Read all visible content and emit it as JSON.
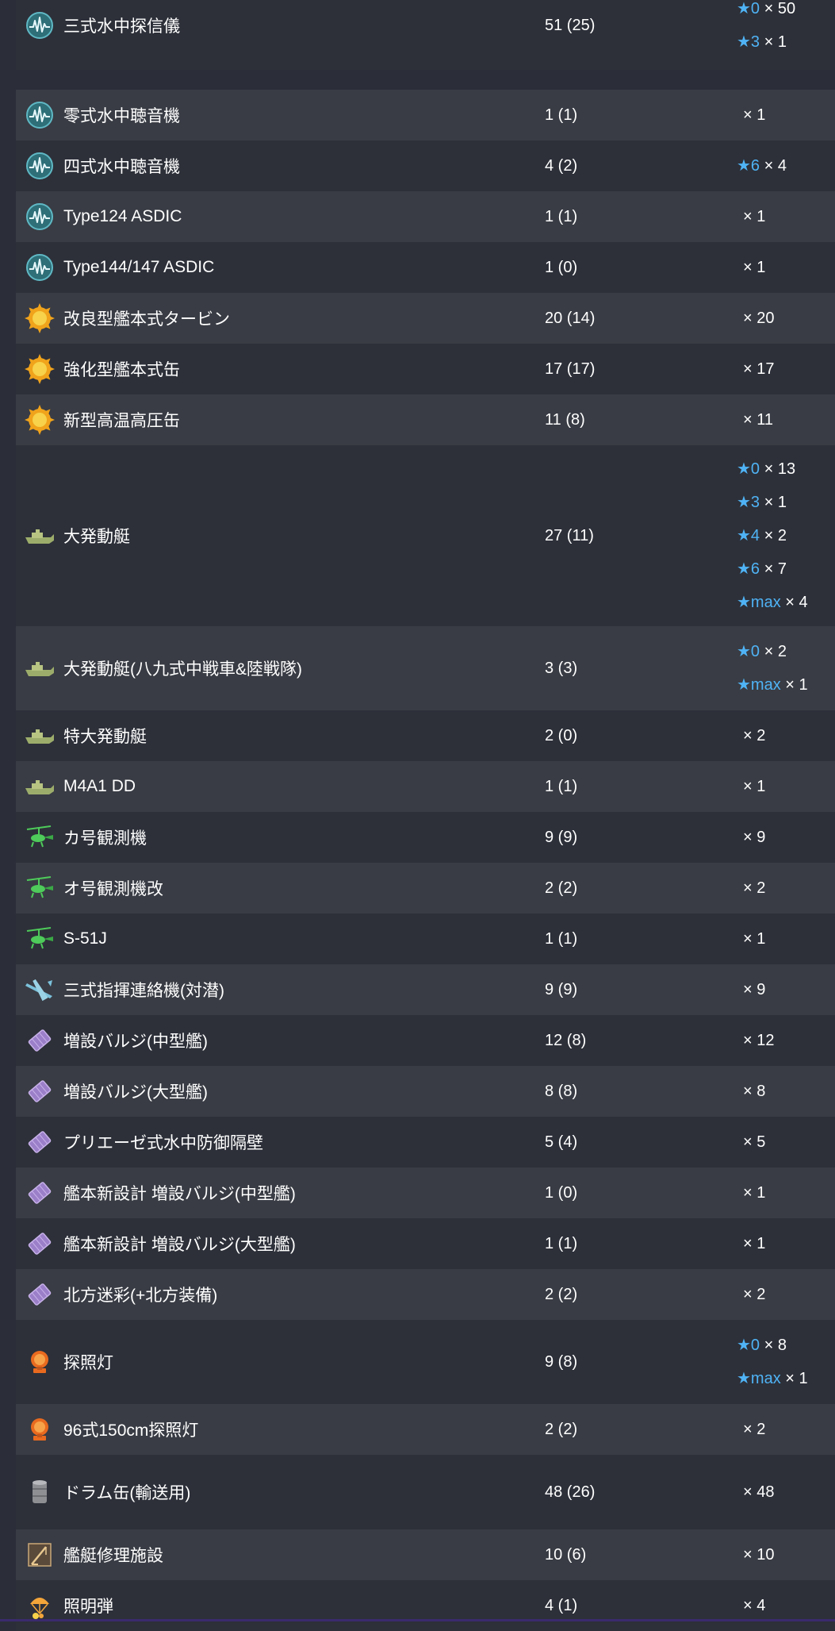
{
  "colors": {
    "row_odd": "#2d3039",
    "row_even": "#393c44",
    "star_level": "#4fb3f5",
    "text": "#ffffff"
  },
  "rows": [
    {
      "icon": "sonar-icon",
      "name": "三式水中探信儀",
      "count": "51 (25)",
      "stars": [
        {
          "level": "★0",
          "mult": "× 50"
        },
        {
          "level": "★3",
          "mult": "× 1"
        }
      ]
    },
    {
      "icon": "sonar-icon",
      "name": "零式水中聴音機",
      "count": "1 (1)",
      "stars": [
        {
          "level": "",
          "mult": "× 1"
        }
      ]
    },
    {
      "icon": "sonar-icon",
      "name": "四式水中聴音機",
      "count": "4 (2)",
      "stars": [
        {
          "level": "★6",
          "mult": "× 4"
        }
      ]
    },
    {
      "icon": "sonar-icon",
      "name": "Type124 ASDIC",
      "count": "1 (1)",
      "stars": [
        {
          "level": "",
          "mult": "× 1"
        }
      ]
    },
    {
      "icon": "sonar-icon",
      "name": "Type144/147 ASDIC",
      "count": "1 (0)",
      "stars": [
        {
          "level": "",
          "mult": "× 1"
        }
      ]
    },
    {
      "icon": "engine-icon",
      "name": "改良型艦本式タービン",
      "count": "20 (14)",
      "stars": [
        {
          "level": "",
          "mult": "× 20"
        }
      ]
    },
    {
      "icon": "engine-icon",
      "name": "強化型艦本式缶",
      "count": "17 (17)",
      "stars": [
        {
          "level": "",
          "mult": "× 17"
        }
      ]
    },
    {
      "icon": "engine-icon",
      "name": "新型高温高圧缶",
      "count": "11 (8)",
      "stars": [
        {
          "level": "",
          "mult": "× 11"
        }
      ]
    },
    {
      "icon": "landing-craft-icon",
      "name": "大発動艇",
      "count": "27 (11)",
      "stars": [
        {
          "level": "★0",
          "mult": "× 13"
        },
        {
          "level": "★3",
          "mult": "× 1"
        },
        {
          "level": "★4",
          "mult": "× 2"
        },
        {
          "level": "★6",
          "mult": "× 7"
        },
        {
          "level": "★max",
          "mult": "× 4"
        }
      ]
    },
    {
      "icon": "landing-craft-icon",
      "name": "大発動艇(八九式中戦車&陸戦隊)",
      "count": "3 (3)",
      "stars": [
        {
          "level": "★0",
          "mult": "× 2"
        },
        {
          "level": "★max",
          "mult": "× 1"
        }
      ]
    },
    {
      "icon": "landing-craft-icon",
      "name": "特大発動艇",
      "count": "2 (0)",
      "stars": [
        {
          "level": "",
          "mult": "× 2"
        }
      ]
    },
    {
      "icon": "landing-craft-icon",
      "name": "M4A1 DD",
      "count": "1 (1)",
      "stars": [
        {
          "level": "",
          "mult": "× 1"
        }
      ]
    },
    {
      "icon": "autogyro-icon",
      "name": "カ号観測機",
      "count": "9 (9)",
      "stars": [
        {
          "level": "",
          "mult": "× 9"
        }
      ]
    },
    {
      "icon": "autogyro-icon",
      "name": "オ号観測機改",
      "count": "2 (2)",
      "stars": [
        {
          "level": "",
          "mult": "× 2"
        }
      ]
    },
    {
      "icon": "autogyro-icon",
      "name": "S-51J",
      "count": "1 (1)",
      "stars": [
        {
          "level": "",
          "mult": "× 1"
        }
      ]
    },
    {
      "icon": "liaison-aircraft-icon",
      "name": "三式指揮連絡機(対潜)",
      "count": "9 (9)",
      "stars": [
        {
          "level": "",
          "mult": "× 9"
        }
      ]
    },
    {
      "icon": "bulge-icon",
      "name": "増設バルジ(中型艦)",
      "count": "12 (8)",
      "stars": [
        {
          "level": "",
          "mult": "× 12"
        }
      ]
    },
    {
      "icon": "bulge-icon",
      "name": "増設バルジ(大型艦)",
      "count": "8 (8)",
      "stars": [
        {
          "level": "",
          "mult": "× 8"
        }
      ]
    },
    {
      "icon": "bulge-icon",
      "name": "プリエーゼ式水中防御隔壁",
      "count": "5 (4)",
      "stars": [
        {
          "level": "",
          "mult": "× 5"
        }
      ]
    },
    {
      "icon": "bulge-icon",
      "name": "艦本新設計 増設バルジ(中型艦)",
      "count": "1 (0)",
      "stars": [
        {
          "level": "",
          "mult": "× 1"
        }
      ]
    },
    {
      "icon": "bulge-icon",
      "name": "艦本新設計 増設バルジ(大型艦)",
      "count": "1 (1)",
      "stars": [
        {
          "level": "",
          "mult": "× 1"
        }
      ]
    },
    {
      "icon": "bulge-icon",
      "name": "北方迷彩(+北方装備)",
      "count": "2 (2)",
      "stars": [
        {
          "level": "",
          "mult": "× 2"
        }
      ]
    },
    {
      "icon": "searchlight-icon",
      "name": "探照灯",
      "count": "9 (8)",
      "stars": [
        {
          "level": "★0",
          "mult": "× 8"
        },
        {
          "level": "★max",
          "mult": "× 1"
        }
      ]
    },
    {
      "icon": "searchlight-icon",
      "name": "96式150cm探照灯",
      "count": "2 (2)",
      "stars": [
        {
          "level": "",
          "mult": "× 2"
        }
      ]
    },
    {
      "icon": "drum-canister-icon",
      "name": "ドラム缶(輸送用)",
      "count": "48 (26)",
      "stars": [
        {
          "level": "",
          "mult": "× 48"
        }
      ]
    },
    {
      "icon": "repair-crane-icon",
      "name": "艦艇修理施設",
      "count": "10 (6)",
      "stars": [
        {
          "level": "",
          "mult": "× 10"
        }
      ]
    },
    {
      "icon": "star-shell-icon",
      "name": "照明弾",
      "count": "4 (1)",
      "stars": [
        {
          "level": "",
          "mult": "× 4"
        }
      ]
    }
  ]
}
